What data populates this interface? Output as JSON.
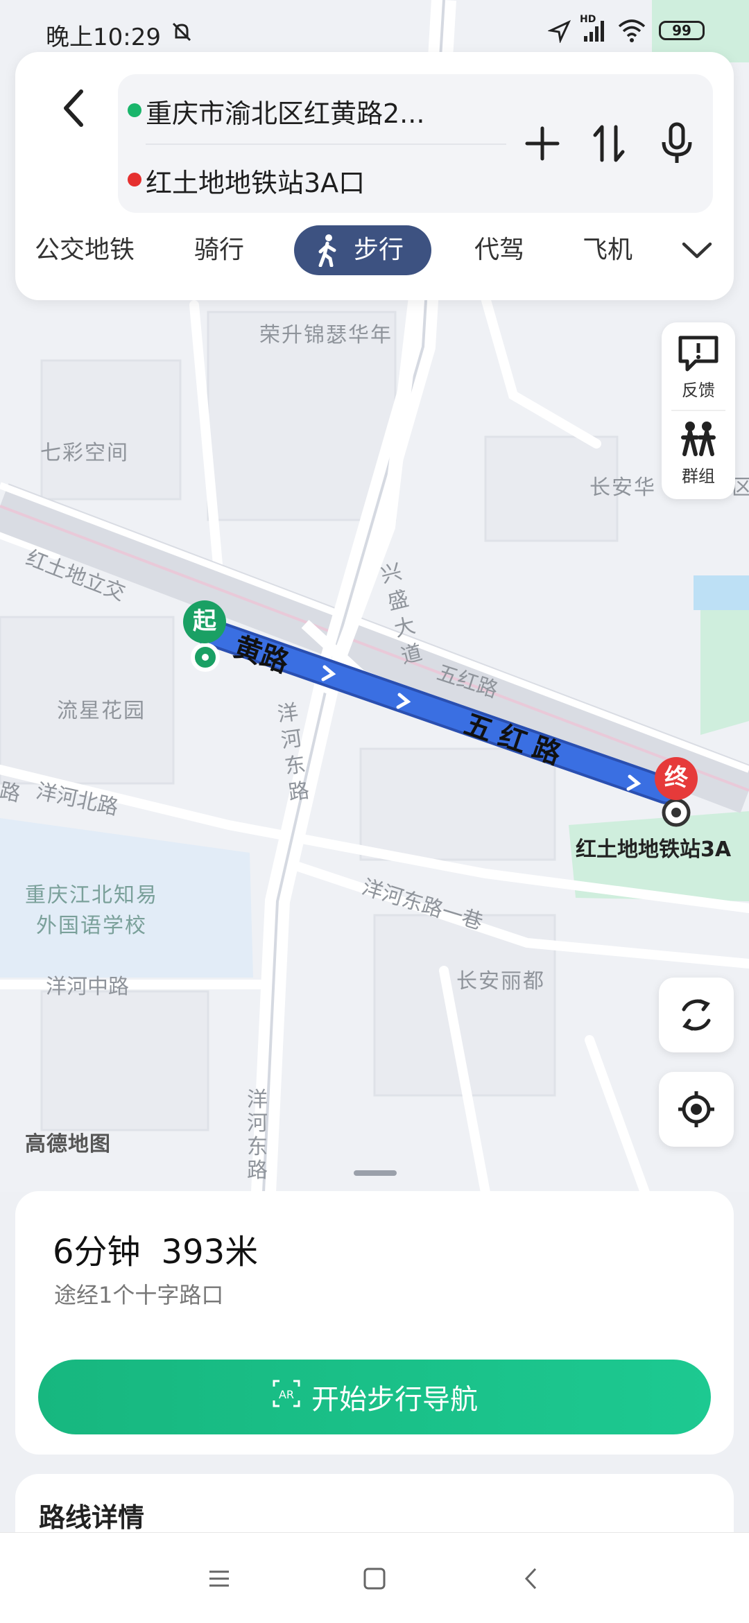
{
  "status_bar": {
    "time": "晚上10:29",
    "hd": "HD",
    "battery": "99"
  },
  "route": {
    "origin": "重庆市渝北区红黄路2...",
    "destination": "红土地地铁站3A口",
    "origin_color": "#19b56b",
    "destination_color": "#e5302f"
  },
  "tabs": [
    "公交地铁",
    "骑行",
    "步行",
    "代驾",
    "飞机"
  ],
  "active_tab": "步行",
  "side": {
    "feedback": "反馈",
    "group": "群组"
  },
  "map": {
    "pois": [
      "荣升锦瑟华年",
      "七彩空间",
      "长安华",
      "区",
      "流星花园",
      "重庆江北知易",
      "外国语学校",
      "长安丽都",
      "高德地图"
    ],
    "roads": [
      "红土地立交",
      "兴盛大道",
      "五红路",
      "洋河东路",
      "洋河北路",
      "路",
      "洋河东路一巷",
      "洋河中路",
      "洋河东路"
    ],
    "route_labels": [
      "黄路",
      "五红路"
    ],
    "start_pin": "起",
    "end_pin": "终",
    "destination_label": "红土地地铁站3A"
  },
  "summary": {
    "duration": "6分钟",
    "distance": "393米",
    "via": "途经1个十字路口"
  },
  "start_button": "开始步行导航",
  "ar_icon": "AR",
  "details_title": "路线详情",
  "colors": {
    "route_blue": "#3a6fe2",
    "primary_green": "#1cc28b",
    "active_tab": "#3d5281"
  }
}
